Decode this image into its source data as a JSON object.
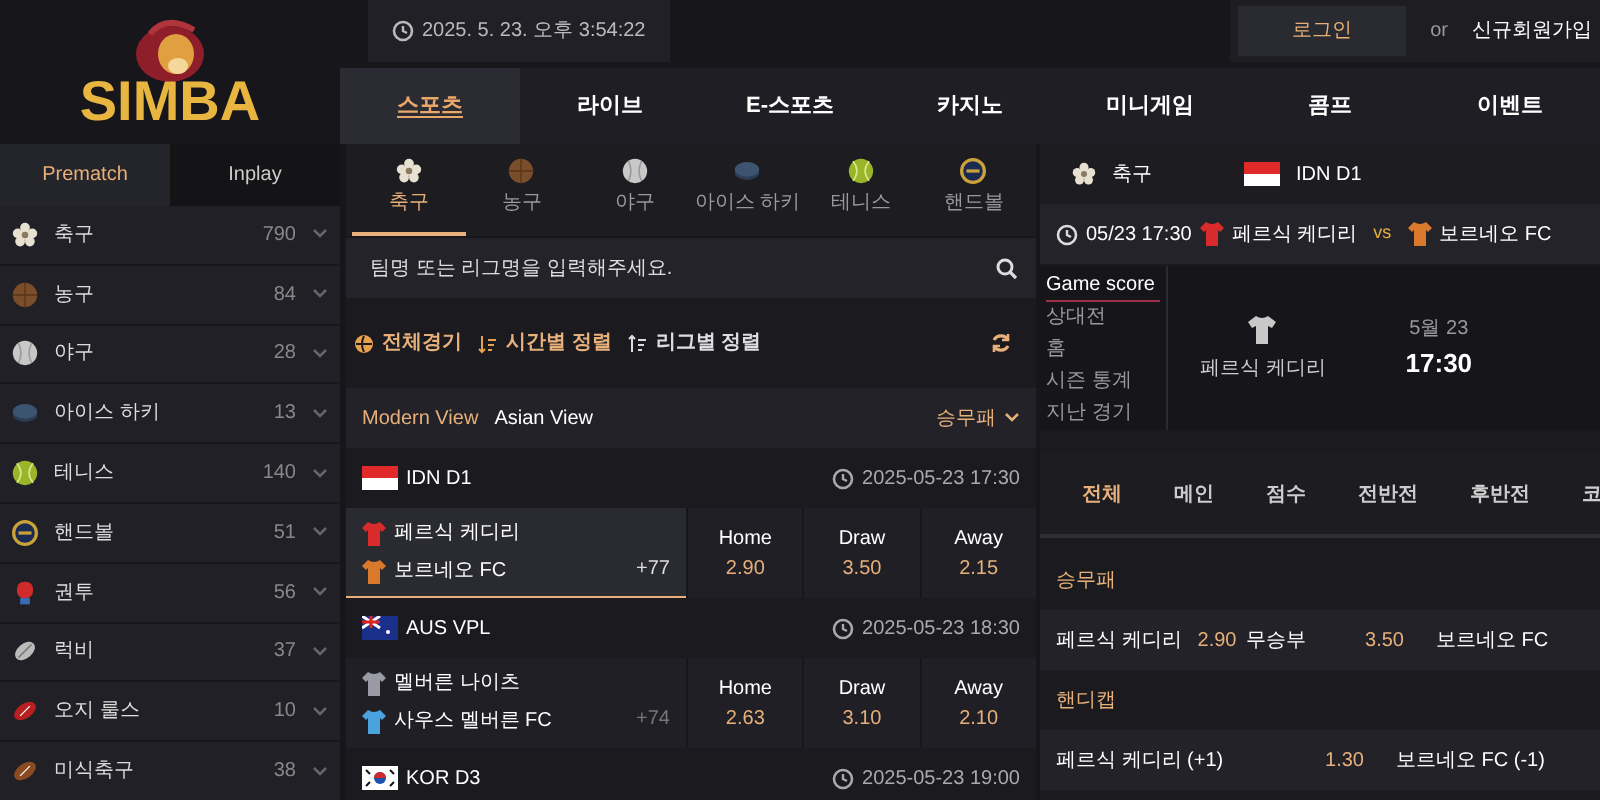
{
  "logo": {
    "text": "SIMBA"
  },
  "clock": {
    "text": "2025. 5. 23. 오후 3:54:22"
  },
  "account": {
    "login": "로그인",
    "or": "or",
    "signup": "신규회원가입"
  },
  "nav_tabs": [
    {
      "label": "스포츠",
      "selected": true
    },
    {
      "label": "라이브",
      "selected": false
    },
    {
      "label": "E-스포츠",
      "selected": false
    },
    {
      "label": "카지노",
      "selected": false
    },
    {
      "label": "미니게임",
      "selected": false
    },
    {
      "label": "콤프",
      "selected": false
    },
    {
      "label": "이벤트",
      "selected": false
    }
  ],
  "sidebar": {
    "tabs": [
      {
        "label": "Prematch",
        "selected": true
      },
      {
        "label": "Inplay",
        "selected": false
      }
    ],
    "items": [
      {
        "kind": "soccer",
        "label": "축구",
        "count": "790"
      },
      {
        "kind": "basketball",
        "label": "농구",
        "count": "84"
      },
      {
        "kind": "baseball",
        "label": "야구",
        "count": "28"
      },
      {
        "kind": "hockey",
        "label": "아이스 하키",
        "count": "13"
      },
      {
        "kind": "tennis",
        "label": "테니스",
        "count": "140"
      },
      {
        "kind": "handball",
        "label": "핸드볼",
        "count": "51"
      },
      {
        "kind": "boxing",
        "label": "권투",
        "count": "56"
      },
      {
        "kind": "rugby",
        "label": "럭비",
        "count": "37"
      },
      {
        "kind": "aussie",
        "label": "오지 룰스",
        "count": "10"
      },
      {
        "kind": "football",
        "label": "미식축구",
        "count": "38"
      }
    ]
  },
  "sport_tabs": [
    {
      "kind": "soccer",
      "label": "축구",
      "selected": true
    },
    {
      "kind": "basketball",
      "label": "농구",
      "selected": false
    },
    {
      "kind": "baseball",
      "label": "야구",
      "selected": false
    },
    {
      "kind": "hockey",
      "label": "아이스 하키",
      "selected": false
    },
    {
      "kind": "tennis",
      "label": "테니스",
      "selected": false
    },
    {
      "kind": "handball",
      "label": "핸드볼",
      "selected": false
    }
  ],
  "search": {
    "placeholder": "팀명 또는 리그명을 입력해주세요."
  },
  "filters": [
    {
      "kind": "all",
      "label": "전체경기",
      "selected": true
    },
    {
      "kind": "time",
      "label": "시간별 정렬",
      "selected": true
    },
    {
      "kind": "league",
      "label": "리그별 정렬",
      "selected": false
    }
  ],
  "views": [
    {
      "label": "Modern View",
      "selected": true
    },
    {
      "label": "Asian View",
      "selected": false
    }
  ],
  "market_select": "승무패",
  "leagues": [
    {
      "kind": "id",
      "name": "IDN D1",
      "time": "2025-05-23 17:30",
      "matches": [
        {
          "selected": true,
          "more": "+77",
          "teams": [
            {
              "name": "페르식 케디리",
              "color": "#d92b2b"
            },
            {
              "name": "보르네오 FC",
              "color": "#d9792b"
            }
          ],
          "odds": [
            {
              "label": "Home",
              "value": "2.90"
            },
            {
              "label": "Draw",
              "value": "3.50"
            },
            {
              "label": "Away",
              "value": "2.15"
            }
          ]
        }
      ]
    },
    {
      "kind": "au",
      "name": "AUS VPL",
      "time": "2025-05-23 18:30",
      "matches": [
        {
          "selected": false,
          "more": "+74",
          "teams": [
            {
              "name": "멜버른 나이츠",
              "color": "#9a9aa6"
            },
            {
              "name": "사우스 멜버른 FC",
              "color": "#4aa3df"
            }
          ],
          "odds": [
            {
              "label": "Home",
              "value": "2.63"
            },
            {
              "label": "Draw",
              "value": "3.10"
            },
            {
              "label": "Away",
              "value": "2.10"
            }
          ]
        }
      ]
    },
    {
      "kind": "kr",
      "name": "KOR D3",
      "time": "2025-05-23 19:00"
    }
  ],
  "detail": {
    "sport": "축구",
    "league": {
      "kind": "id",
      "name": "IDN D1"
    },
    "time": "05/23 17:30",
    "home": {
      "name": "페르식 케디리",
      "color": "#d92b2b"
    },
    "vs": "vs",
    "away": {
      "name": "보르네오 FC",
      "color": "#d9792b"
    },
    "score_menu": [
      {
        "label": "Game score",
        "selected": true
      },
      {
        "label": "상대전",
        "selected": false
      },
      {
        "label": "홈",
        "selected": false
      },
      {
        "label": "시즌 통계",
        "selected": false
      },
      {
        "label": "지난 경기",
        "selected": false
      }
    ],
    "scoreboard": {
      "team": "페르식 케디리",
      "date": "5월 23",
      "time": "17:30"
    },
    "market_tabs": [
      {
        "label": "전체",
        "selected": true
      },
      {
        "label": "메인",
        "selected": false
      },
      {
        "label": "점수",
        "selected": false
      },
      {
        "label": "전반전",
        "selected": false
      },
      {
        "label": "후반전",
        "selected": false
      },
      {
        "label": "코",
        "selected": false
      }
    ],
    "markets": [
      {
        "title": "승무패",
        "selections": [
          {
            "label": "페르식 케디리",
            "odds": "2.90"
          },
          {
            "label": "무승부",
            "odds": "3.50"
          },
          {
            "label": "보르네오 FC"
          }
        ]
      },
      {
        "title": "핸디캡",
        "selections": [
          {
            "label": "페르식 케디리 (+1)",
            "odds": "1.30"
          },
          {
            "label": "보르네오 FC (-1)"
          }
        ]
      }
    ]
  }
}
